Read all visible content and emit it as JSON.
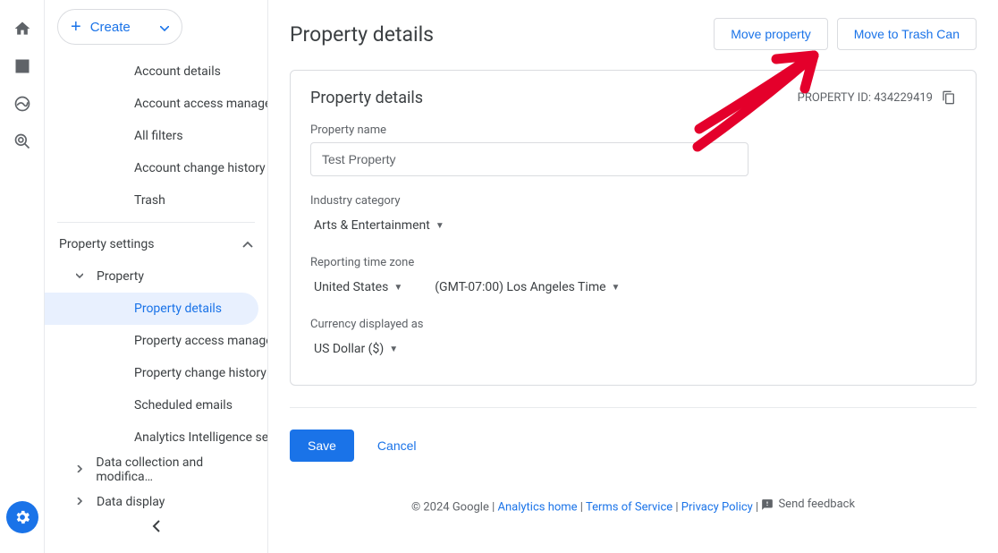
{
  "create_button": "Create",
  "sidebar": {
    "account_items": [
      "Account details",
      "Account access managem…",
      "All filters",
      "Account change history",
      "Trash"
    ],
    "section_head": "Property settings",
    "property_label": "Property",
    "property_items": [
      "Property details",
      "Property access managem…",
      "Property change history",
      "Scheduled emails",
      "Analytics Intelligence sear…"
    ],
    "more_sections": [
      "Data collection and modifica…",
      "Data display"
    ]
  },
  "header": {
    "title": "Property details",
    "move_btn": "Move property",
    "trash_btn": "Move to Trash Can"
  },
  "card": {
    "title": "Property details",
    "prop_id_label": "PROPERTY ID:",
    "prop_id_value": "434229419",
    "name_label": "Property name",
    "name_value": "Test Property",
    "industry_label": "Industry category",
    "industry_value": "Arts & Entertainment",
    "tz_label": "Reporting time zone",
    "tz_country": "United States",
    "tz_value": "(GMT-07:00) Los Angeles Time",
    "currency_label": "Currency displayed as",
    "currency_value": "US Dollar ($)"
  },
  "actions": {
    "save": "Save",
    "cancel": "Cancel"
  },
  "footer": {
    "copyright": "© 2024 Google",
    "home": "Analytics home",
    "tos": "Terms of Service",
    "privacy": "Privacy Policy",
    "feedback": "Send feedback"
  }
}
